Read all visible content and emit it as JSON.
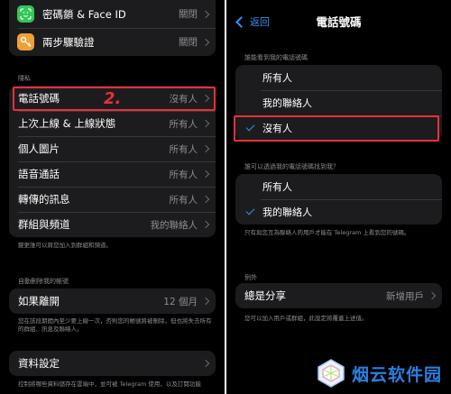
{
  "left": {
    "top_rows": [
      {
        "label": "密碼鎖 & Face ID",
        "value": "關閉",
        "icon": "face-id-icon",
        "icon_color": "#34c759"
      },
      {
        "label": "兩步驟驗證",
        "value": "關閉",
        "icon": "key-icon",
        "icon_color": "#f0a035"
      }
    ],
    "privacy_header": "隱私",
    "privacy_rows": [
      {
        "label": "電話號碼",
        "value": "沒有人"
      },
      {
        "label": "上次上線 & 上線狀態",
        "value": "所有人"
      },
      {
        "label": "個人圖片",
        "value": "所有人"
      },
      {
        "label": "語音通話",
        "value": "所有人"
      },
      {
        "label": "轉傳的訊息",
        "value": "所有人"
      },
      {
        "label": "群組與頻道",
        "value": "我的聯絡人"
      }
    ],
    "privacy_footnote": "變更誰可以將您加入到群組和頻道。",
    "auto_delete_header": "自動刪除我的帳號",
    "auto_delete_row": {
      "label": "如果離開",
      "value": "12 個月"
    },
    "auto_delete_footnote": "您在該段期間內至少要上線一次，否則您的帳號將被刪除，但也將失去所有的群組、訊息及聯絡人。",
    "data_row": {
      "label": "資料設定"
    },
    "data_footnote": "控制將哪些資料儲存在雲端中，並可被 Telegram 使用，以及訂閱功能",
    "step_marker": "2."
  },
  "right": {
    "back_label": "返回",
    "title": "電話號碼",
    "who_sees_header": "誰能看到我的電話號碼",
    "who_sees_options": [
      {
        "label": "所有人",
        "checked": false
      },
      {
        "label": "我的聯絡人",
        "checked": false
      },
      {
        "label": "沒有人",
        "checked": true
      }
    ],
    "who_finds_header": "誰可以透過我的電話號碼找到我？",
    "who_finds_options": [
      {
        "label": "所有人",
        "checked": false
      },
      {
        "label": "我的聯絡人",
        "checked": true
      }
    ],
    "who_finds_footnote": "只有與您互為聯絡人的用戶才能在 Telegram 上看到您的號碼。",
    "exceptions_header": "例外",
    "always_share": {
      "label": "總是分享",
      "value": "新增用戶"
    },
    "exceptions_footnote": "您可以加入用戶或群組，此設定將覆蓋上述值。"
  },
  "watermark": "烟云软件园",
  "colors": {
    "accent": "#3b8fee",
    "highlight": "#e8303a",
    "background": "#000000",
    "cell": "#1c1c1e"
  }
}
